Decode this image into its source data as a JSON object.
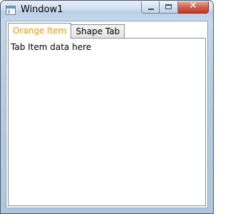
{
  "window": {
    "title": "Window1",
    "icon": "app-window-icon",
    "caption_buttons": {
      "minimize": "minimize-icon",
      "maximize": "maximize-icon",
      "close_glyph": "✕"
    }
  },
  "tabs": [
    {
      "label": "Orange Item",
      "selected": true,
      "color": "#ff9c00"
    },
    {
      "label": "Shape Tab",
      "selected": false
    }
  ],
  "panel": {
    "content": "Tab Item data here"
  }
}
